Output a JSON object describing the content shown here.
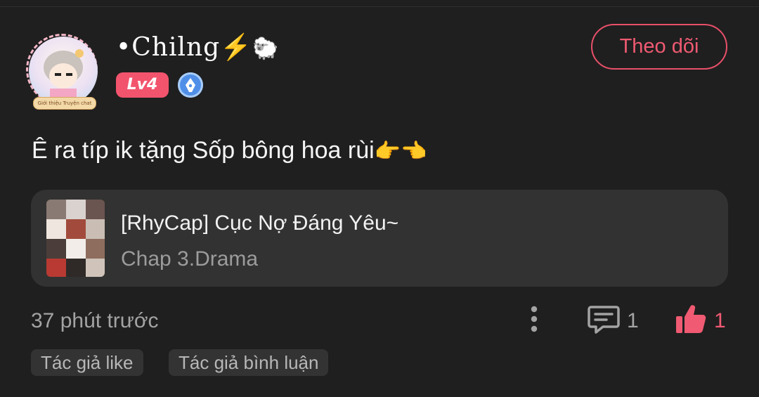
{
  "post": {
    "user": {
      "name": "•Chilng",
      "name_bolt": "⚡",
      "name_sheep": "🐑",
      "level": "Lv4",
      "avatar_frame_text": "Giới thiệu Truyện chat",
      "avatar_icon": "avatar-with-decorated-frame",
      "badge_icon": "pen-nib-icon"
    },
    "follow_label": "Theo dõi",
    "comment_text": "Ê ra típ ik tặng Sốp bông hoa rùi",
    "comment_emojis": "👉👈",
    "linked_story": {
      "title": "[RhyCap] Cục Nợ Đáng Yêu~",
      "subtitle": "Chap 3.Drama",
      "thumbnail_icon": "story-cover-collage"
    },
    "timestamp": "37 phút trước",
    "comment_count": "1",
    "like_count": "1",
    "tags": {
      "author_liked": "Tác giả like",
      "author_commented": "Tác giả bình luận"
    }
  },
  "colors": {
    "background": "#1f1f1f",
    "card": "#323232",
    "accent": "#f05a72",
    "muted_text": "#a3a3a3"
  }
}
